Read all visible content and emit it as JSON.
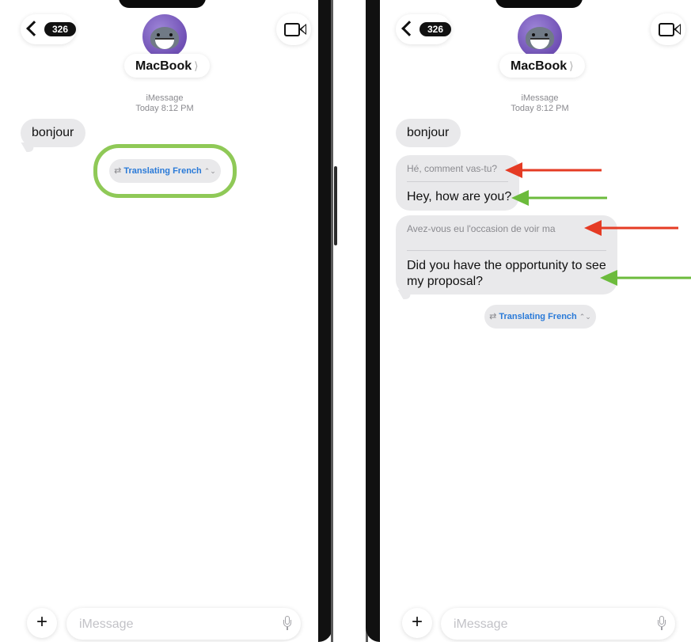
{
  "header": {
    "unread_count": "326",
    "contact_name": "MacBook",
    "name_chevron": "⟩"
  },
  "meta": {
    "service": "iMessage",
    "timestamp": "Today 8:12 PM"
  },
  "left_screen": {
    "messages": [
      {
        "text": "bonjour"
      }
    ],
    "translate_pill": {
      "icon": "⇄",
      "label": "Translating French",
      "chevron": "⌃⌄"
    }
  },
  "right_screen": {
    "messages": [
      {
        "text": "bonjour"
      },
      {
        "original": "Hé, comment vas-tu?",
        "translation": "Hey, how are you?"
      },
      {
        "original": "Avez-vous eu l'occasion de voir ma",
        "translation_line1": "Did you have the opportunity to see",
        "translation_line2": "my proposal?"
      }
    ],
    "translate_pill": {
      "icon": "⇄",
      "label": "Translating French",
      "chevron": "⌃⌄"
    }
  },
  "composer": {
    "plus_label": "+",
    "placeholder": "iMessage"
  },
  "colors": {
    "highlight_ring": "#8fc957",
    "arrow_red": "#e53b24",
    "arrow_green": "#6cbb3c",
    "link_blue": "#2a7ad8"
  }
}
